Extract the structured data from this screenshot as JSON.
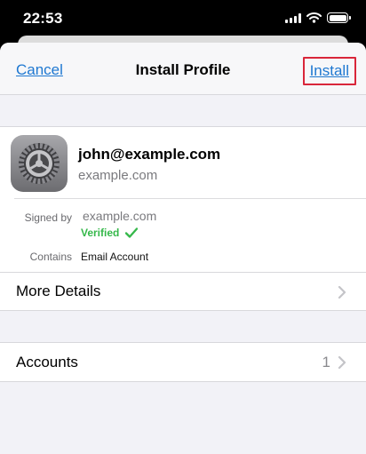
{
  "status_bar": {
    "time": "22:53",
    "icons": [
      "signal-icon",
      "wifi-icon",
      "battery-icon"
    ]
  },
  "nav": {
    "cancel_label": "Cancel",
    "title": "Install Profile",
    "install_label": "Install"
  },
  "profile": {
    "icon": "settings-gear-icon",
    "name": "john@example.com",
    "domain": "example.com",
    "signed_by_label": "Signed by",
    "signed_by_value": "example.com",
    "verified_label": "Verified",
    "contains_label": "Contains",
    "contains_value": "Email Account"
  },
  "rows": {
    "more_details": "More Details",
    "accounts": "Accounts",
    "accounts_count": "1"
  },
  "colors": {
    "link": "#1f78d1",
    "verified": "#35b84a",
    "highlight": "#d9263a"
  }
}
